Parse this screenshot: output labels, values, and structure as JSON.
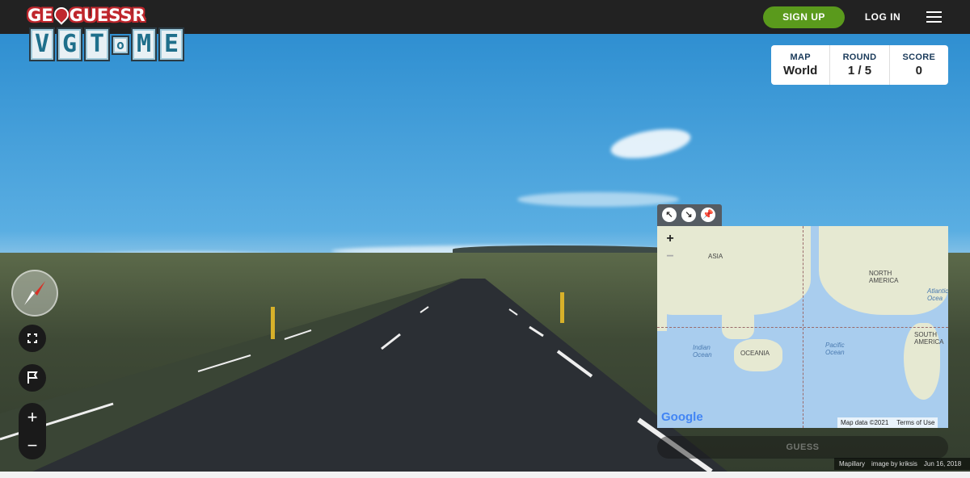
{
  "header": {
    "logo_left": "GE",
    "logo_right": "GUESSR",
    "signup_label": "SIGN UP",
    "login_label": "LOG IN",
    "menu_icon": "hamburger-icon"
  },
  "watermark": {
    "letters": [
      "V",
      "G",
      "T",
      "o",
      "M",
      "E"
    ]
  },
  "status": {
    "map_label": "MAP",
    "map_value": "World",
    "round_label": "ROUND",
    "round_value": "1 / 5",
    "score_label": "SCORE",
    "score_value": "0"
  },
  "controls": {
    "compass_icon": "compass-icon",
    "fullscreen_icon": "fullscreen-icon",
    "flag_icon": "flag-icon",
    "zoom_in": "+",
    "zoom_out": "−"
  },
  "minimap": {
    "tools": [
      "↖",
      "↘",
      "📌"
    ],
    "zoom_in": "+",
    "zoom_out": "−",
    "labels": {
      "asia": "ASIA",
      "north_america": "NORTH AMERICA",
      "south_america": "SOUTH AMERICA",
      "oceania": "OCEANIA",
      "indian_ocean": "Indian Ocean",
      "pacific_ocean": "Pacific Ocean",
      "atlantic_ocean": "Atlantic Ocea"
    },
    "google_logo": "Google",
    "map_data": "Map data ©2021",
    "terms": "Terms of Use",
    "guess_label": "GUESS"
  },
  "attribution": {
    "provider": "Mapillary",
    "image_by": "image by kriksis",
    "date": "Jun 16, 2018"
  }
}
